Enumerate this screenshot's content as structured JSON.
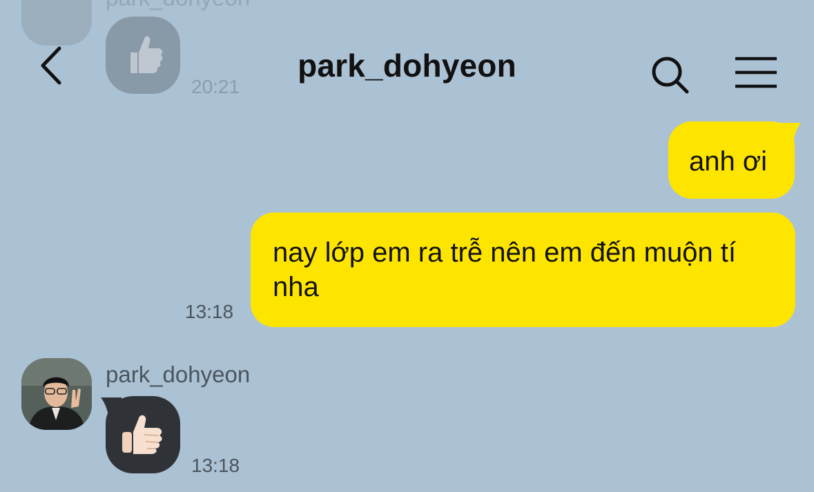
{
  "header": {
    "title": "park_dohyeon",
    "back_icon": "chevron-left-icon",
    "search_icon": "search-icon",
    "menu_icon": "hamburger-menu-icon"
  },
  "ghost": {
    "sender": "park_dohyeon",
    "time": "20:21"
  },
  "messages": {
    "out_1": {
      "text": "anh ơi"
    },
    "out_2": {
      "text": "nay lớp em ra trễ nên em đến muộn tí nha",
      "time": "13:18"
    },
    "in_1": {
      "sender": "park_dohyeon",
      "emoji": "👍🏻",
      "time": "13:18"
    }
  },
  "colors": {
    "background": "#abc1d4",
    "outgoing_bubble": "#fee500",
    "incoming_bubble": "#2f3337"
  }
}
